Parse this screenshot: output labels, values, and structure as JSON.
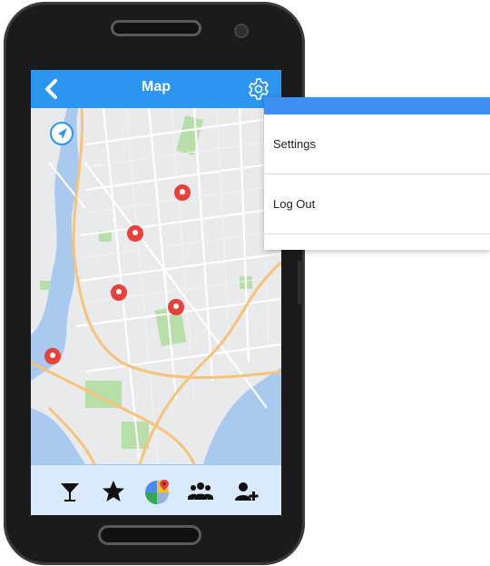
{
  "header": {
    "title": "Map"
  },
  "zoom": {
    "plus_label": "+",
    "minus_label": "−"
  },
  "menu": {
    "items": [
      {
        "label": "Settings"
      },
      {
        "label": "Log Out"
      }
    ]
  },
  "tabs": [
    {
      "icon": "cocktail-icon"
    },
    {
      "icon": "star-icon"
    },
    {
      "icon": "maps-app-icon"
    },
    {
      "icon": "group-icon"
    },
    {
      "icon": "add-user-icon"
    }
  ],
  "colors": {
    "appbar": "#2b95f0",
    "menu_header": "#3f8ff2",
    "bottom_bar": "#d8eafc",
    "pin": "#e8403b",
    "water": "#a9c9ef",
    "park": "#b7dfa7",
    "highway": "#f7c37a"
  }
}
